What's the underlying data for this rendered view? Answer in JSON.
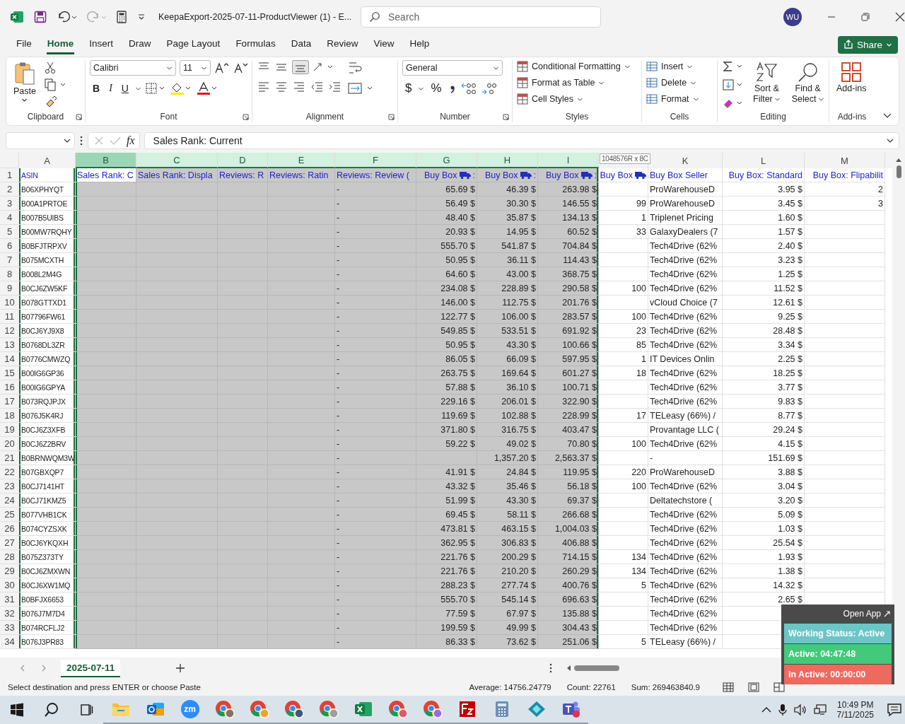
{
  "title_bar": {
    "file_title": "KeepaExport-2025-07-11-ProductViewer (1)  -  E...",
    "search": {
      "placeholder": "Search"
    },
    "avatar": "WU"
  },
  "menu_tabs": [
    {
      "label": "File",
      "selected": false
    },
    {
      "label": "Home",
      "selected": true
    },
    {
      "label": "Insert",
      "selected": false
    },
    {
      "label": "Draw",
      "selected": false
    },
    {
      "label": "Page Layout",
      "selected": false
    },
    {
      "label": "Formulas",
      "selected": false
    },
    {
      "label": "Data",
      "selected": false
    },
    {
      "label": "Review",
      "selected": false
    },
    {
      "label": "View",
      "selected": false
    },
    {
      "label": "Help",
      "selected": false
    }
  ],
  "share": "Share",
  "ribbon": {
    "clipboard": {
      "paste": "Paste",
      "label": "Clipboard"
    },
    "font": {
      "family": "Calibri",
      "size": "11",
      "bold": "B",
      "italic": "I",
      "underline": "U",
      "label": "Font"
    },
    "alignment": {
      "label": "Alignment"
    },
    "number": {
      "format": "General",
      "currency": "$",
      "percent": "%",
      "label": "Number"
    },
    "styles": {
      "items": [
        "Conditional Formatting",
        "Format as Table",
        "Cell Styles"
      ],
      "label": "Styles"
    },
    "cells": {
      "items": [
        "Insert",
        "Delete",
        "Format"
      ],
      "label": "Cells"
    },
    "editing": {
      "sort": [
        "Sort &",
        "Filter"
      ],
      "find": [
        "Find &",
        "Select"
      ],
      "label": "Editing"
    },
    "addins": {
      "button": "Add-ins",
      "label": "Add-ins"
    }
  },
  "formula_bar": {
    "fx": "fx",
    "formula": "Sales Rank: Current"
  },
  "selection_tooltip": "1048576R x 8C",
  "columns": [
    {
      "letter": "A",
      "selected": false,
      "active": false,
      "copied": true
    },
    {
      "letter": "B",
      "selected": true,
      "active": true,
      "copied": false
    },
    {
      "letter": "C",
      "selected": true,
      "active": false,
      "copied": false
    },
    {
      "letter": "D",
      "selected": true,
      "active": false,
      "copied": false
    },
    {
      "letter": "E",
      "selected": true,
      "active": false,
      "copied": false
    },
    {
      "letter": "F",
      "selected": true,
      "active": false,
      "copied": false
    },
    {
      "letter": "G",
      "selected": true,
      "active": false,
      "copied": false
    },
    {
      "letter": "H",
      "selected": true,
      "active": false,
      "copied": false
    },
    {
      "letter": "I",
      "selected": true,
      "active": false,
      "copied": false
    },
    {
      "selected": false,
      "active": false,
      "copied": false
    },
    {
      "letter": "K",
      "selected": false,
      "active": false,
      "copied": false
    },
    {
      "letter": "L",
      "selected": false,
      "active": false,
      "copied": false
    },
    {
      "letter": "M",
      "selected": false,
      "active": false,
      "copied": false
    }
  ],
  "header_row": {
    "num": "1",
    "A": {
      "text": "ASIN",
      "truck": false
    },
    "B": {
      "text": "Sales Rank: C",
      "truck": false
    },
    "C": {
      "text": "Sales Rank: Displa",
      "truck": false
    },
    "D": {
      "text": "Reviews: R",
      "truck": false
    },
    "E": {
      "text": "Reviews: Ratin",
      "truck": false
    },
    "F": {
      "text": "Reviews: Review (",
      "truck": false
    },
    "G": {
      "text": "Buy Box",
      "truck": true,
      "suffix": ":"
    },
    "H": {
      "text": "Buy Box",
      "truck": true,
      "suffix": ":"
    },
    "I": {
      "text": "Buy Box",
      "truck": true,
      "suffix": ":"
    },
    "J": {
      "text": "Buy Box",
      "truck": true
    },
    "K": {
      "text": "Buy Box Seller",
      "truck": false
    },
    "L": {
      "text": "Buy Box: Standard",
      "truck": false
    },
    "M": {
      "text": "Buy Box: Flipabilit",
      "truck": false
    }
  },
  "rows": [
    {
      "num": "2",
      "A": "B06XPHYQT",
      "F": "-",
      "G": "65.69 $",
      "H": "46.39 $",
      "I": "263.98 $",
      "K": "ProWarehouseD",
      "L": "3.95 $",
      "M": "2"
    },
    {
      "num": "3",
      "A": "B00A1PRTOE",
      "F": "-",
      "G": "56.49 $",
      "H": "30.30 $",
      "I": "146.55 $",
      "J": "99",
      "K": "ProWarehouseD",
      "L": "3.45 $",
      "M": "3"
    },
    {
      "num": "4",
      "A": "B007B5UIBS",
      "F": "-",
      "G": "48.40 $",
      "H": "35.87 $",
      "I": "134.13 $",
      "J": "1",
      "K": "Triplenet Pricing",
      "L": "1.60 $"
    },
    {
      "num": "5",
      "A": "B00MW7RQHY",
      "F": "-",
      "G": "20.93 $",
      "H": "14.95 $",
      "I": "60.52 $",
      "J": "33",
      "K": "GalaxyDealers (7",
      "L": "1.57 $"
    },
    {
      "num": "6",
      "A": "B0BFJTRPXV",
      "F": "-",
      "G": "555.70 $",
      "H": "541.87 $",
      "I": "704.84 $",
      "K": "Tech4Drive (62%",
      "L": "2.40 $"
    },
    {
      "num": "7",
      "A": "B075MCXTH",
      "F": "-",
      "G": "50.95 $",
      "H": "36.11 $",
      "I": "114.43 $",
      "K": "Tech4Drive (62%",
      "L": "3.23 $"
    },
    {
      "num": "8",
      "A": "B008L2M4G",
      "F": "-",
      "G": "64.60 $",
      "H": "43.00 $",
      "I": "368.75 $",
      "K": "Tech4Drive (62%",
      "L": "1.25 $"
    },
    {
      "num": "9",
      "A": "B0CJ6ZW5KF",
      "F": "-",
      "G": "234.08 $",
      "H": "228.89 $",
      "I": "290.58 $",
      "J": "100",
      "K": "Tech4Drive (62%",
      "L": "11.52 $"
    },
    {
      "num": "10",
      "A": "B078GTTXD1",
      "F": "-",
      "G": "146.00 $",
      "H": "112.75 $",
      "I": "201.76 $",
      "K": "vCloud Choice (7",
      "L": "12.61 $"
    },
    {
      "num": "11",
      "A": "B07796FW61",
      "F": "-",
      "G": "122.77 $",
      "H": "106.00 $",
      "I": "283.57 $",
      "J": "100",
      "K": "Tech4Drive (62%",
      "L": "9.25 $"
    },
    {
      "num": "12",
      "A": "B0CJ6YJ9X8",
      "F": "-",
      "G": "549.85 $",
      "H": "533.51 $",
      "I": "691.92 $",
      "J": "23",
      "K": "Tech4Drive (62%",
      "L": "28.48 $"
    },
    {
      "num": "13",
      "A": "B0768DL3ZR",
      "F": "-",
      "G": "50.95 $",
      "H": "43.30 $",
      "I": "100.66 $",
      "J": "85",
      "K": "Tech4Drive (62%",
      "L": "3.34 $"
    },
    {
      "num": "14",
      "A": "B0776CMWZQ",
      "F": "-",
      "G": "86.05 $",
      "H": "66.09 $",
      "I": "597.95 $",
      "J": "1",
      "K": "IT Devices Onlin",
      "L": "2.25 $"
    },
    {
      "num": "15",
      "A": "B00IG6GP36",
      "F": "-",
      "G": "263.75 $",
      "H": "169.64 $",
      "I": "601.27 $",
      "J": "18",
      "K": "Tech4Drive (62%",
      "L": "18.25 $"
    },
    {
      "num": "16",
      "A": "B00IG6GPYA",
      "F": "-",
      "G": "57.88 $",
      "H": "36.10 $",
      "I": "100.71 $",
      "K": "Tech4Drive (62%",
      "L": "3.77 $"
    },
    {
      "num": "17",
      "A": "B073RQJPJX",
      "F": "-",
      "G": "229.16 $",
      "H": "206.01 $",
      "I": "322.90 $",
      "K": "Tech4Drive (62%",
      "L": "9.83 $"
    },
    {
      "num": "18",
      "A": "B076J5K4RJ",
      "F": "-",
      "G": "119.69 $",
      "H": "102.88 $",
      "I": "228.99 $",
      "J": "17",
      "K": "TELeasy (66%) /",
      "L": "8.77 $"
    },
    {
      "num": "19",
      "A": "B0CJ6Z3XFB",
      "F": "-",
      "G": "371.80 $",
      "H": "316.75 $",
      "I": "403.47 $",
      "K": "Provantage LLC (",
      "L": "29.24 $"
    },
    {
      "num": "20",
      "A": "B0CJ6Z2BRV",
      "F": "-",
      "G": "59.22 $",
      "H": "49.02 $",
      "I": "70.80 $",
      "J": "100",
      "K": "Tech4Drive (62%",
      "L": "4.15 $"
    },
    {
      "num": "21",
      "A": "B0BRNWQM3W",
      "F": "-",
      "H": "1,357.20 $",
      "I": "2,563.37 $",
      "K": "-",
      "L": "151.69 $"
    },
    {
      "num": "22",
      "A": "B07GBXQP7",
      "F": "-",
      "G": "41.91 $",
      "H": "24.84 $",
      "I": "119.95 $",
      "J": "220",
      "K": "ProWarehouseD",
      "L": "3.88 $"
    },
    {
      "num": "23",
      "A": "B0CJ7141HT",
      "F": "-",
      "G": "43.32 $",
      "H": "35.46 $",
      "I": "56.18 $",
      "J": "100",
      "K": "Tech4Drive (62%",
      "L": "3.04 $"
    },
    {
      "num": "24",
      "A": "B0CJ71KMZ5",
      "F": "-",
      "G": "51.99 $",
      "H": "43.30 $",
      "I": "69.37 $",
      "K": "Deltatechstore (",
      "L": "3.20 $"
    },
    {
      "num": "25",
      "A": "B077VHB1CK",
      "F": "-",
      "G": "69.45 $",
      "H": "58.11 $",
      "I": "266.68 $",
      "K": "Tech4Drive (62%",
      "L": "5.09 $"
    },
    {
      "num": "26",
      "A": "B074CYZSXK",
      "F": "-",
      "G": "473.81 $",
      "H": "463.15 $",
      "I": "1,004.03 $",
      "K": "Tech4Drive (62%",
      "L": "1.03 $"
    },
    {
      "num": "27",
      "A": "B0CJ6YKQXH",
      "F": "-",
      "G": "362.95 $",
      "H": "306.83 $",
      "I": "406.88 $",
      "K": "Tech4Drive (62%",
      "L": "25.54 $"
    },
    {
      "num": "28",
      "A": "B075Z373TY",
      "F": "-",
      "G": "221.76 $",
      "H": "200.29 $",
      "I": "714.15 $",
      "J": "134",
      "K": "Tech4Drive (62%",
      "L": "1.93 $"
    },
    {
      "num": "29",
      "A": "B0CJ6ZMXWN",
      "F": "-",
      "G": "221.76 $",
      "H": "210.20 $",
      "I": "260.29 $",
      "J": "134",
      "K": "Tech4Drive (62%",
      "L": "1.38 $"
    },
    {
      "num": "30",
      "A": "B0CJ6XW1MQ",
      "F": "-",
      "G": "288.23 $",
      "H": "277.74 $",
      "I": "400.76 $",
      "J": "5",
      "K": "Tech4Drive (62%",
      "L": "14.32 $"
    },
    {
      "num": "31",
      "A": "B0BFJX6653",
      "F": "-",
      "G": "555.70 $",
      "H": "545.14 $",
      "I": "696.63 $",
      "K": "Tech4Drive (62%",
      "L": "2.65 $"
    },
    {
      "num": "32",
      "A": "B076J7M7D4",
      "F": "-",
      "G": "77.59 $",
      "H": "67.97 $",
      "I": "135.88 $",
      "K": "Tech4Drive (62%"
    },
    {
      "num": "33",
      "A": "B074RCFLJ2",
      "F": "-",
      "G": "199.59 $",
      "H": "49.99 $",
      "I": "304.43 $",
      "K": "Tech4Drive (62%"
    },
    {
      "num": "34",
      "A": "B076J3PR83",
      "F": "-",
      "G": "86.33 $",
      "H": "73.62 $",
      "I": "251.06 $",
      "J": "5",
      "K": "TELeasy (66%) /"
    }
  ],
  "sheet_tabs": [
    {
      "label": "2025-07-11",
      "selected": true
    }
  ],
  "status_bar": {
    "message": "Select destination and press ENTER or choose Paste",
    "average": "Average: 14756.24779",
    "count": "Count: 22761",
    "sum": "Sum: 269463840.9"
  },
  "tracker": {
    "open_app": "Open App",
    "working_status": "Working Status: Active",
    "active": "Active: 04:47:48",
    "inactive": "In Active: 00:00:00"
  },
  "taskbar": {
    "apps": [
      {
        "kind": "files"
      },
      {
        "kind": "mail"
      },
      {
        "kind": "zoom",
        "text": "zm"
      },
      {
        "kind": "browser",
        "color": "#8d6e63"
      },
      {
        "kind": "browser",
        "color": "#f0a030"
      },
      {
        "kind": "browser",
        "color": "#3d5a80"
      },
      {
        "kind": "browser",
        "color": "#9e9e9e"
      },
      {
        "kind": "excel"
      },
      {
        "kind": "browser",
        "color": "#e05a6a"
      },
      {
        "kind": "browser",
        "color": "#9c6ade"
      },
      {
        "kind": "ftp"
      },
      {
        "kind": "calculator"
      },
      {
        "kind": "diamond"
      },
      {
        "kind": "teams"
      }
    ],
    "time": "10:49 PM",
    "date": "7/11/2025"
  }
}
